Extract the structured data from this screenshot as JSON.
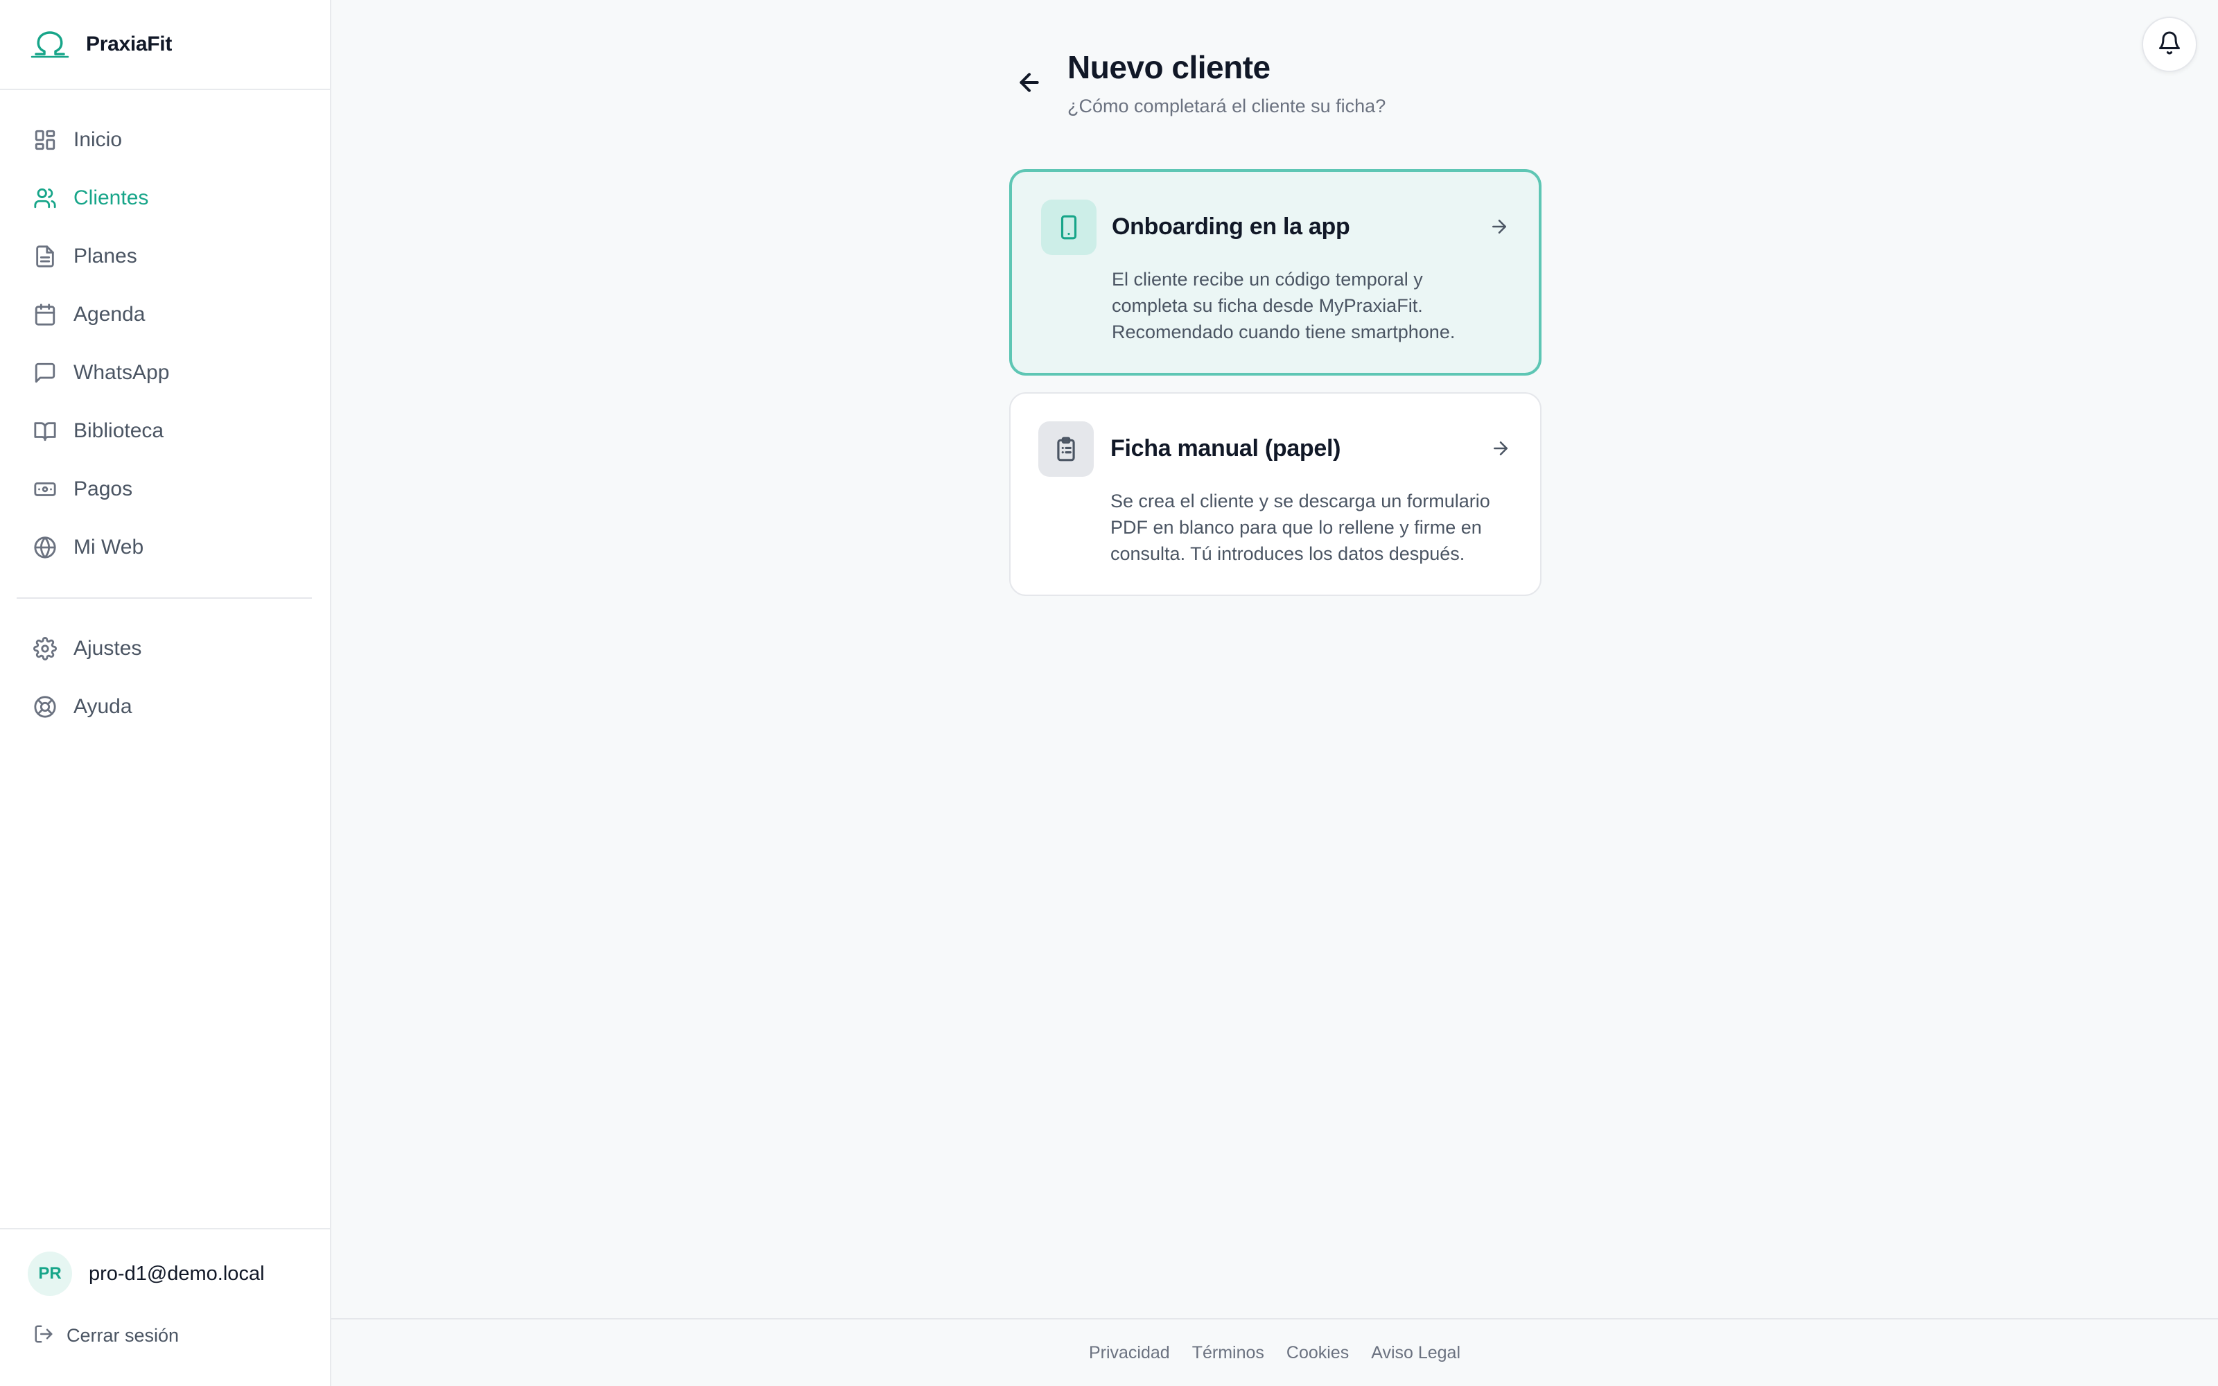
{
  "brand": {
    "name": "PraxiaFit",
    "logo_icon": "omega-logo-icon",
    "accent_color": "#17a589"
  },
  "sidebar": {
    "items": [
      {
        "label": "Inicio",
        "icon": "dashboard-icon",
        "active": false
      },
      {
        "label": "Clientes",
        "icon": "users-icon",
        "active": true
      },
      {
        "label": "Planes",
        "icon": "document-icon",
        "active": false
      },
      {
        "label": "Agenda",
        "icon": "calendar-icon",
        "active": false
      },
      {
        "label": "WhatsApp",
        "icon": "chat-icon",
        "active": false
      },
      {
        "label": "Biblioteca",
        "icon": "book-icon",
        "active": false
      },
      {
        "label": "Pagos",
        "icon": "banknote-icon",
        "active": false
      },
      {
        "label": "Mi Web",
        "icon": "globe-icon",
        "active": false
      }
    ],
    "secondary_items": [
      {
        "label": "Ajustes",
        "icon": "gear-icon"
      },
      {
        "label": "Ayuda",
        "icon": "lifebuoy-icon"
      }
    ],
    "user": {
      "initials": "PR",
      "email": "pro-d1@demo.local"
    },
    "logout_label": "Cerrar sesión"
  },
  "header": {
    "title": "Nuevo cliente",
    "subtitle": "¿Cómo completará el cliente su ficha?"
  },
  "options": [
    {
      "title": "Onboarding en la app",
      "description": "El cliente recibe un código temporal y completa su ficha desde MyPraxiaFit. Recomendado cuando tiene smartphone.",
      "icon": "smartphone-icon",
      "selected": true
    },
    {
      "title": "Ficha manual (papel)",
      "description": "Se crea el cliente y se descarga un formulario PDF en blanco para que lo rellene y firme en consulta. Tú introduces los datos después.",
      "icon": "clipboard-icon",
      "selected": false
    }
  ],
  "footer": {
    "links": [
      "Privacidad",
      "Términos",
      "Cookies",
      "Aviso Legal"
    ]
  }
}
